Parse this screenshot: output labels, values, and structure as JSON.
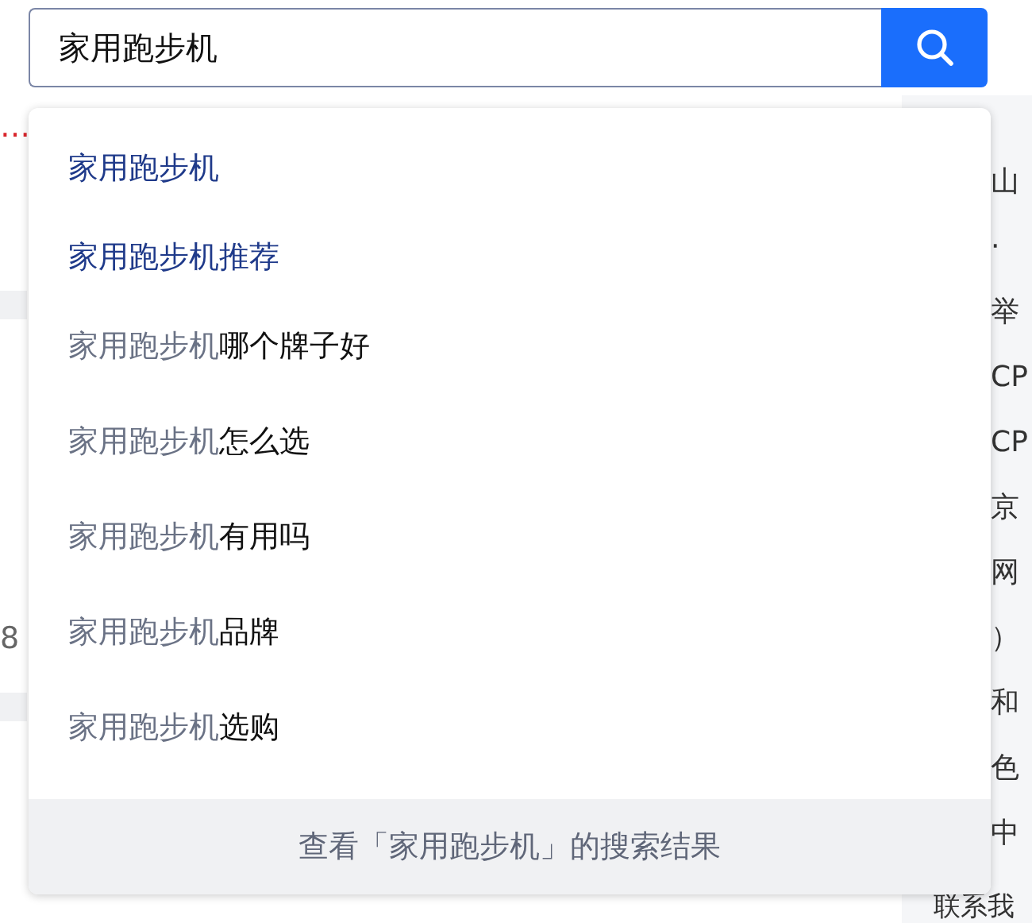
{
  "search": {
    "value": "家用跑步机"
  },
  "background": {
    "left": [
      {
        "text": "…",
        "kind": "link"
      },
      {
        "text": "8",
        "kind": "meta"
      }
    ],
    "right": [
      "山",
      "·",
      "举",
      "CP",
      "CP",
      "京",
      "网",
      "）",
      "和",
      "色",
      "中"
    ],
    "bottom_right": "联系我"
  },
  "suggestions": [
    {
      "kind": "related",
      "text": "家用跑步机"
    },
    {
      "kind": "related",
      "text": "家用跑步机推荐"
    },
    {
      "kind": "completion",
      "prefix": "家用跑步机",
      "suffix": "哪个牌子好"
    },
    {
      "kind": "completion",
      "prefix": "家用跑步机",
      "suffix": "怎么选"
    },
    {
      "kind": "completion",
      "prefix": "家用跑步机",
      "suffix": "有用吗"
    },
    {
      "kind": "completion",
      "prefix": "家用跑步机",
      "suffix": "品牌"
    },
    {
      "kind": "completion",
      "prefix": "家用跑步机",
      "suffix": "选购"
    }
  ],
  "footer": "查看「家用跑步机」的搜索结果"
}
